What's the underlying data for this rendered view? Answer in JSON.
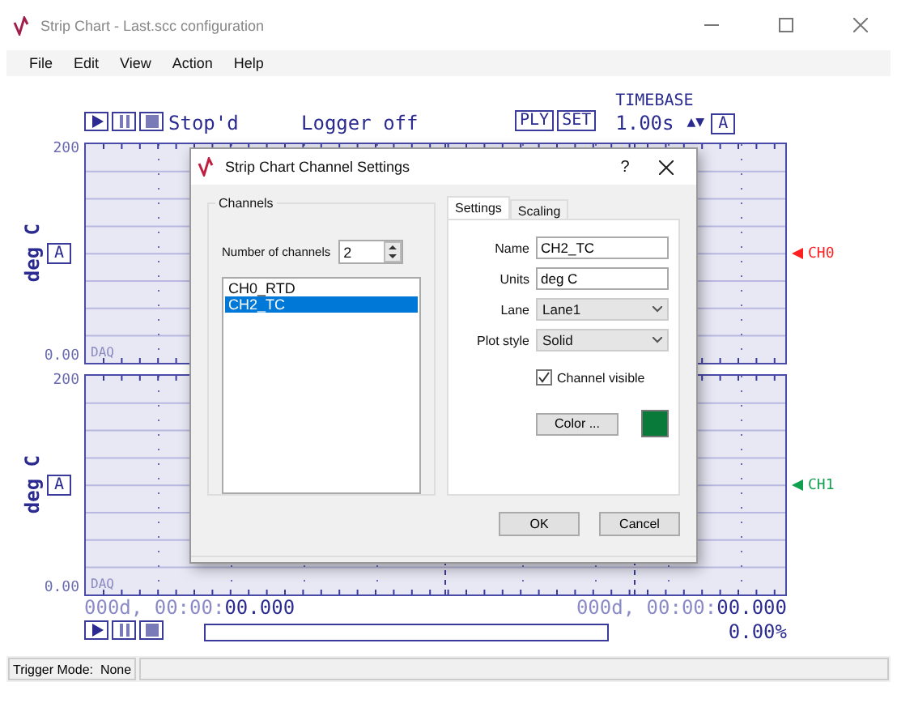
{
  "window": {
    "title": "Strip Chart - Last.scc configuration"
  },
  "menu": [
    "File",
    "Edit",
    "View",
    "Action",
    "Help"
  ],
  "toolbar": {
    "status": "Stop'd",
    "logger": "Logger off",
    "buttons": [
      "PLY",
      "SET"
    ],
    "timebase_label": "TIMEBASE",
    "timebase_value": "1.00s",
    "spin": "▲▼",
    "auto": "A"
  },
  "lanes": [
    {
      "ymax": "200",
      "ymin": "0.00",
      "units": "deg C",
      "auto": "A",
      "source": "DAQ",
      "channel": {
        "label": "CH0",
        "color": "#ff2020"
      }
    },
    {
      "ymax": "200",
      "ymin": "0.00",
      "units": "deg C",
      "auto": "A",
      "source": "DAQ",
      "channel": {
        "label": "CH1",
        "color": "#10a050"
      }
    }
  ],
  "footer": {
    "start_time": "000d, 00:00:**00.000**",
    "end_time": "000d, 00:00:**00.000**",
    "progress": {
      "level": 0,
      "reading": "0.00%"
    }
  },
  "status_bar": {
    "trigger": "Trigger Mode:  None"
  },
  "dialog": {
    "title": "Strip Chart Channel Settings",
    "help": "?",
    "group": "Channels",
    "count_label": "Number of channels",
    "count_value": "2",
    "channels": [
      {
        "name": "CH0_RTD",
        "selected": false
      },
      {
        "name": "CH2_TC",
        "selected": true
      }
    ],
    "tabs": [
      {
        "label": "Settings",
        "selected": true
      },
      {
        "label": "Scaling",
        "selected": false
      }
    ],
    "fields": [
      {
        "kind": "text",
        "label": "Name",
        "value": "CH2_TC"
      },
      {
        "kind": "text",
        "label": "Units",
        "value": "deg C"
      },
      {
        "kind": "select",
        "label": "Lane",
        "value": "Lane1"
      },
      {
        "kind": "select",
        "label": "Plot style",
        "value": "Solid"
      }
    ],
    "visible": {
      "label": "Channel visible",
      "checked": true
    },
    "color_button": "Color ...",
    "swatch": {
      "color": "#0a7a3a"
    },
    "buttons": [
      "OK",
      "Cancel"
    ]
  }
}
